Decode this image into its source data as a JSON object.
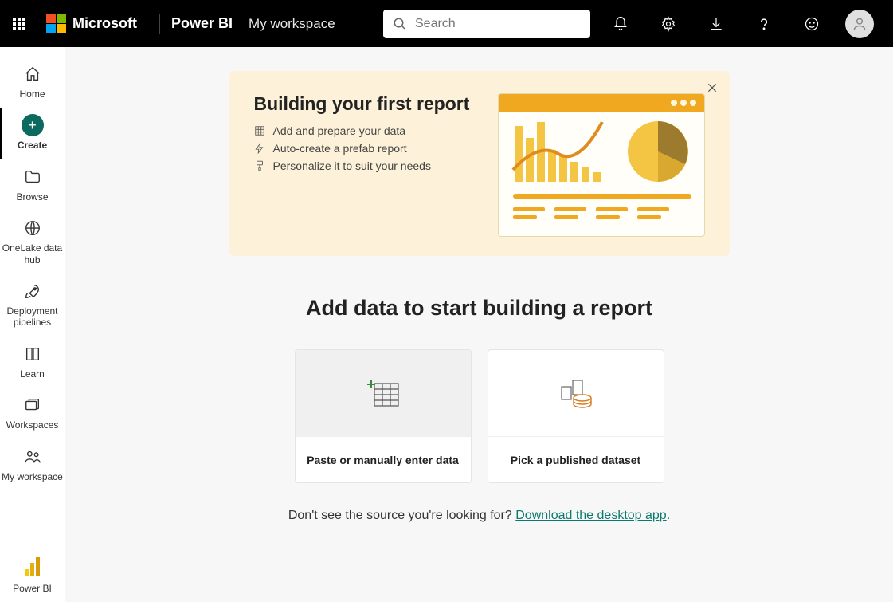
{
  "header": {
    "ms_label": "Microsoft",
    "product": "Power BI",
    "workspace": "My workspace",
    "search_placeholder": "Search"
  },
  "sidebar": {
    "home": "Home",
    "create": "Create",
    "browse": "Browse",
    "onelake": "OneLake data hub",
    "deployment": "Deployment pipelines",
    "learn": "Learn",
    "workspaces": "Workspaces",
    "myworkspace": "My workspace",
    "powerbi": "Power BI"
  },
  "banner": {
    "title": "Building your first report",
    "step1": "Add and prepare your data",
    "step2": "Auto-create a prefab report",
    "step3": "Personalize it to suit your needs"
  },
  "main": {
    "heading": "Add data to start building a report",
    "card1": "Paste or manually enter data",
    "card2": "Pick a published dataset",
    "footer_text": "Don't see the source you're looking for?  ",
    "footer_link": "Download the desktop app",
    "footer_period": "."
  }
}
